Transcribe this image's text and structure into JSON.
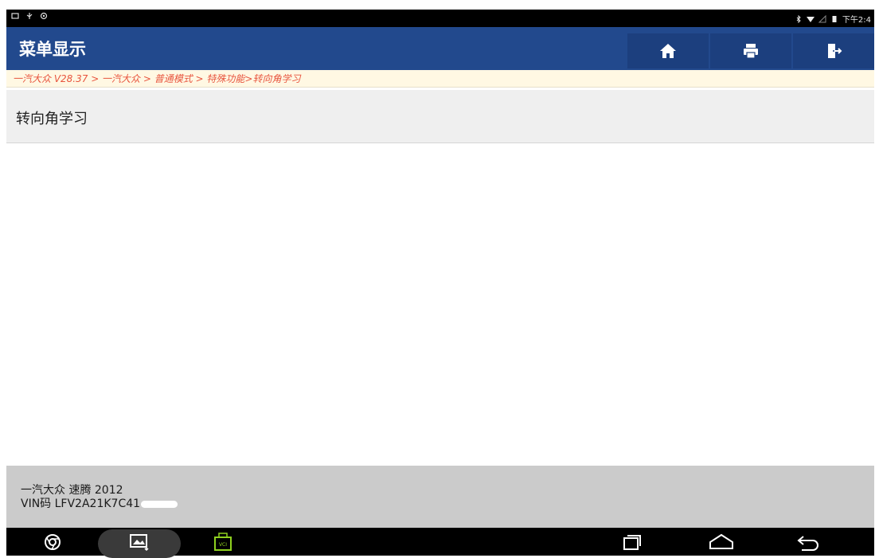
{
  "status_bar": {
    "time": "下午2:4",
    "icons": [
      "screen-icon",
      "usb-icon",
      "settings-icon",
      "bluetooth-icon",
      "wifi-icon",
      "signal-icon",
      "battery-icon"
    ]
  },
  "header": {
    "title": "菜单显示",
    "buttons": [
      "home-icon",
      "print-icon",
      "exit-icon"
    ],
    "color": "#22498d"
  },
  "breadcrumb": {
    "text": "一汽大众 V28.37 > 一汽大众 > 普通模式 > 特殊功能>转向角学习",
    "color": "#e8553f"
  },
  "menu": {
    "items": [
      {
        "label": "转向角学习"
      }
    ]
  },
  "vehicle": {
    "line1": "一汽大众 速腾 2012",
    "vin_label": "VIN码 LFV2A21K7C41"
  },
  "nav_bar": {
    "icons": [
      "browser-icon",
      "screenshot-icon",
      "vci-icon",
      "recent-apps-icon",
      "home-nav-icon",
      "back-icon"
    ],
    "vci_label": "VCI"
  }
}
